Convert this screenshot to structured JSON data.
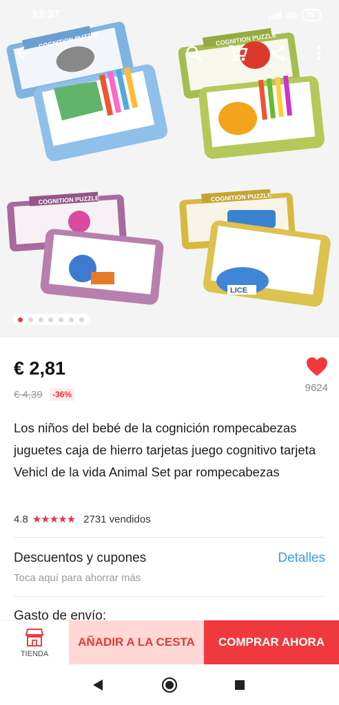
{
  "status_bar": {
    "time": "13:37",
    "network": "4G",
    "battery": "97"
  },
  "product_gallery": {
    "image_count": 7,
    "active_index": 0,
    "box_labels": [
      "COGNITION PUZZLE",
      "COGNITION PUZZLE",
      "COGNITION PUZZLE",
      "COGNITION PUZZLE"
    ],
    "card_text": "LICE",
    "colors": {
      "blue_box": "#7fb3e0",
      "green_box": "#a5bd4e",
      "purple_box": "#a86a9e",
      "yellow_box": "#d8b93f"
    }
  },
  "price": {
    "current": "€ 2,81",
    "original": "€ 4,39",
    "discount": "-36%"
  },
  "wishlist": {
    "count": "9624"
  },
  "product": {
    "title": "Los niños del bebé de la cognición rompecabezas juguetes caja de hierro tarjetas juego cognitivo tarjeta Vehicl de la vida Animal Set par rompecabezas"
  },
  "rating": {
    "score": "4.8",
    "stars": "★★★★★",
    "sold": "2731 vendidos"
  },
  "coupons": {
    "label": "Descuentos y cupones",
    "subtitle": "Toca aquí para ahorrar más",
    "details_link": "Detalles"
  },
  "shipping": {
    "label": "Gasto de envío:"
  },
  "bottom_bar": {
    "store_label": "TIENDA",
    "add_to_cart": "AÑADIR A LA CESTA",
    "buy_now": "COMPRAR AHORA"
  },
  "theme": {
    "accent": "#f0393f",
    "link": "#3a9fd8"
  }
}
